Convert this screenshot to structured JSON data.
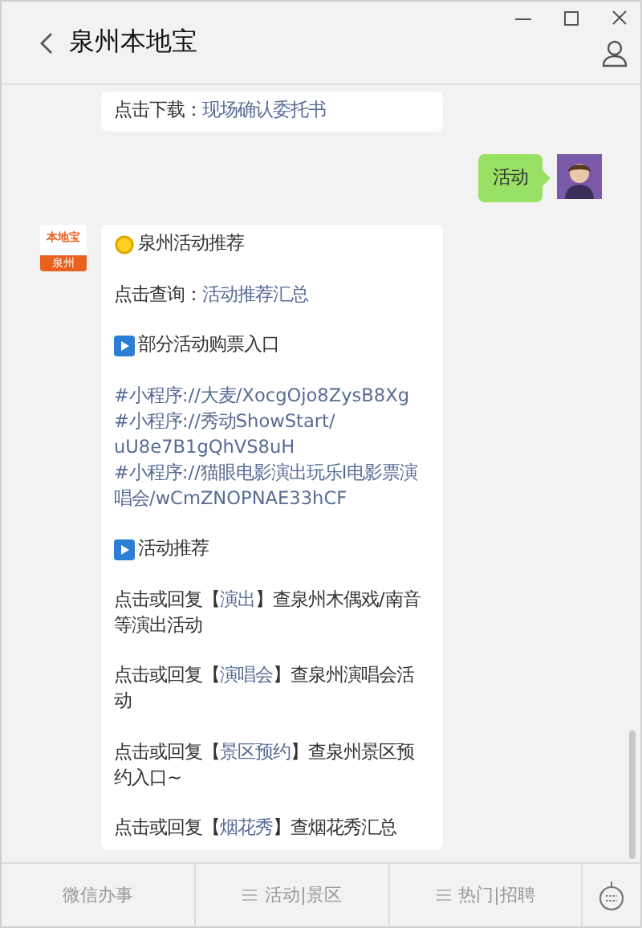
{
  "window": {
    "title": "泉州本地宝"
  },
  "messages": [
    {
      "kind": "received",
      "paragraphs": [
        {
          "kind": "text",
          "parts": [
            {
              "kind": "text",
              "text": "点击下载："
            },
            {
              "kind": "link",
              "text": "现场确认委托书"
            }
          ]
        }
      ]
    },
    {
      "kind": "sent",
      "avatar": {
        "kind": "picture"
      },
      "paragraphs": [
        {
          "kind": "text",
          "parts": [
            {
              "kind": "text",
              "text": "活动"
            }
          ]
        }
      ]
    },
    {
      "kind": "received",
      "logo": {
        "brand": "本地宝",
        "city": "泉州"
      },
      "paragraphs": [
        {
          "kind": "sun-heading",
          "parts": [
            {
              "kind": "text",
              "text": "泉州活动推荐"
            }
          ]
        },
        {
          "kind": "text",
          "parts": [
            {
              "kind": "text",
              "text": "点击查询："
            },
            {
              "kind": "link",
              "text": "活动推荐汇总"
            }
          ]
        },
        {
          "kind": "play-heading",
          "parts": [
            {
              "kind": "text",
              "text": "部分活动购票入口"
            }
          ]
        },
        {
          "kind": "links",
          "links": [
            "#小程序://大麦/XocgOjo8ZysB8Xg",
            "#小程序://秀动ShowStart/uU8e7B1gQhVS8uH",
            "#小程序://猫眼电影演出玩乐I电影票演唱会/wCmZNOPNAE33hCF"
          ]
        },
        {
          "kind": "play-heading",
          "parts": [
            {
              "kind": "text",
              "text": "活动推荐"
            }
          ]
        },
        {
          "kind": "text",
          "parts": [
            {
              "kind": "text",
              "text": "点击或回复【"
            },
            {
              "kind": "link",
              "text": "演出"
            },
            {
              "kind": "text",
              "text": "】查泉州木偶戏/南音等演出活动"
            }
          ]
        },
        {
          "kind": "text",
          "parts": [
            {
              "kind": "text",
              "text": "点击或回复【"
            },
            {
              "kind": "link",
              "text": "演唱会"
            },
            {
              "kind": "text",
              "text": "】查泉州演唱会活动"
            }
          ]
        },
        {
          "kind": "text",
          "parts": [
            {
              "kind": "text",
              "text": "点击或回复【"
            },
            {
              "kind": "link",
              "text": "景区预约"
            },
            {
              "kind": "text",
              "text": "】查泉州景区预约入口~"
            }
          ]
        },
        {
          "kind": "text",
          "parts": [
            {
              "kind": "text",
              "text": "点击或回复【"
            },
            {
              "kind": "link",
              "text": "烟花秀"
            },
            {
              "kind": "text",
              "text": "】查烟花秀汇总"
            }
          ]
        }
      ]
    }
  ],
  "menu": [
    {
      "label": "微信办事",
      "has_submenu": false
    },
    {
      "label": "活动|景区",
      "has_submenu": true
    },
    {
      "label": "热门|招聘",
      "has_submenu": true
    }
  ]
}
